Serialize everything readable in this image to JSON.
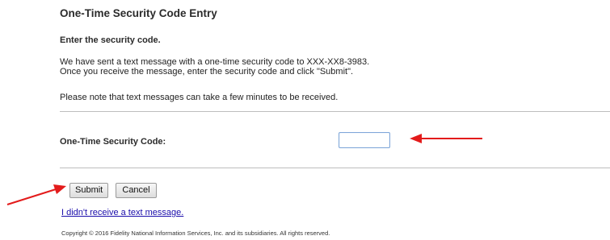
{
  "header": {
    "title": "One-Time Security Code Entry",
    "subtitle": "Enter the security code."
  },
  "message": {
    "line1": "We have sent a text message with a one-time security code to XXX-XX8-3983.",
    "line2": "Once you receive the message, enter the security code and click \"Submit\".",
    "note": "Please note that text messages can take a few minutes to be received."
  },
  "form": {
    "code_label": "One-Time Security Code:",
    "code_value": "",
    "submit_label": "Submit",
    "cancel_label": "Cancel"
  },
  "links": {
    "no_text": "I didn't receive a text message."
  },
  "footer": {
    "copyright": "Copyright © 2016 Fidelity National Information Services, Inc. and its subsidiaries. All rights reserved."
  },
  "colors": {
    "annotation_arrow": "#e31b1b",
    "link": "#1a0dab",
    "input_border": "#7fa7d9"
  }
}
